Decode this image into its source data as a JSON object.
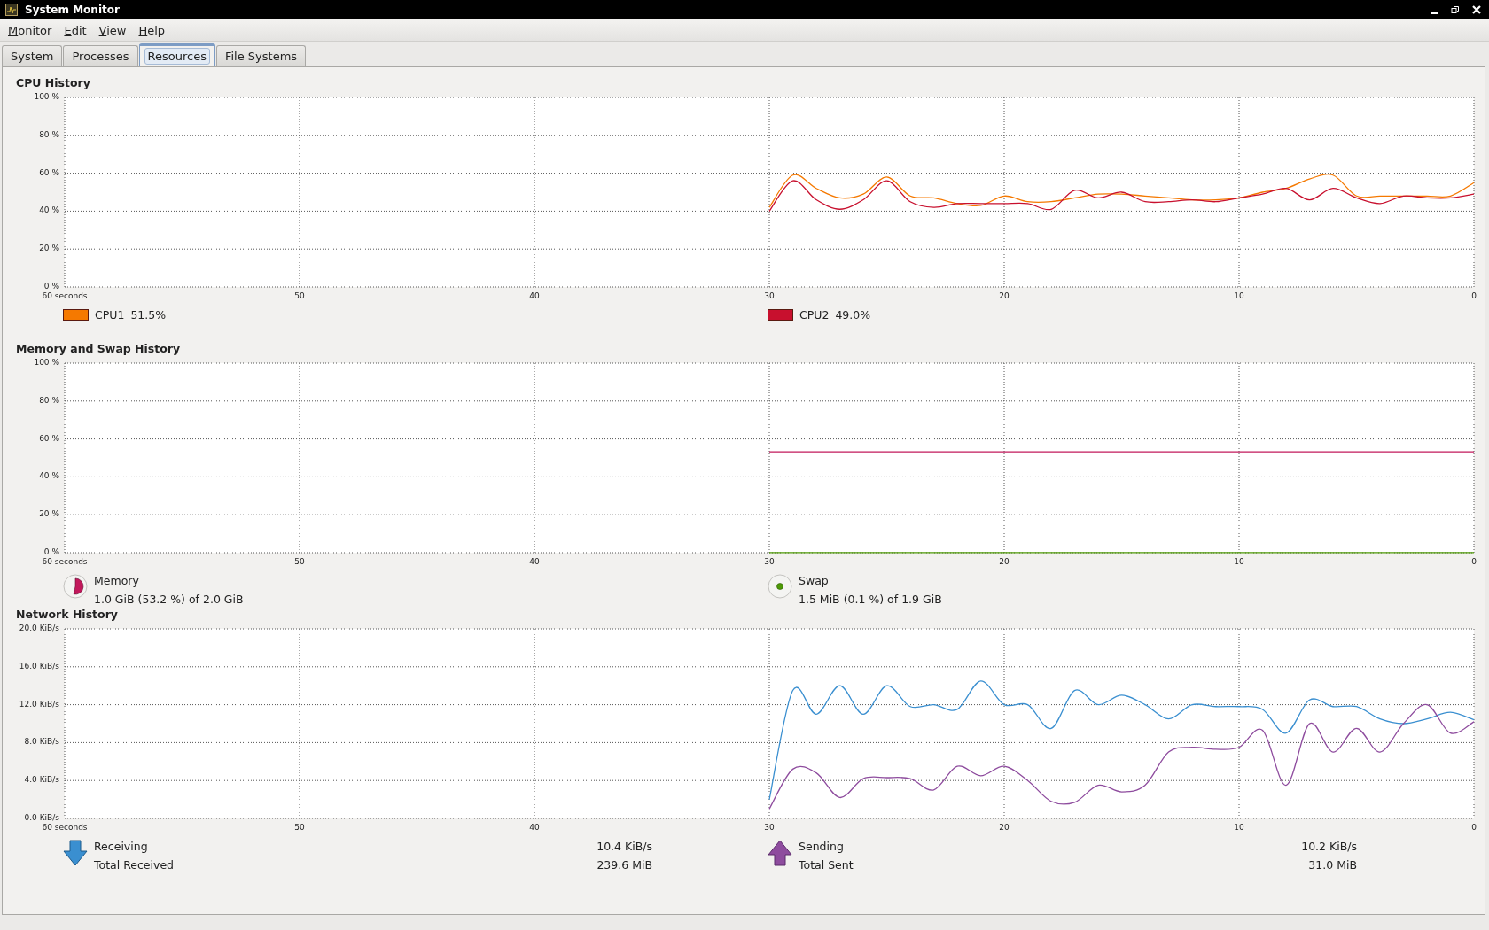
{
  "window": {
    "title": "System Monitor"
  },
  "menu": [
    {
      "label": "Monitor"
    },
    {
      "label": "Edit"
    },
    {
      "label": "View"
    },
    {
      "label": "Help"
    }
  ],
  "tabs": [
    {
      "label": "System",
      "selected": false
    },
    {
      "label": "Processes",
      "selected": false
    },
    {
      "label": "Resources",
      "selected": true
    },
    {
      "label": "File Systems",
      "selected": false
    }
  ],
  "sections": [
    {
      "kind": "cpu",
      "title": "CPU History",
      "chart_data": {
        "type": "line",
        "grid": true,
        "xlim": [
          60,
          0
        ],
        "ylim": [
          0,
          100
        ],
        "xticks": [
          {
            "value": 60,
            "label": "60 seconds"
          },
          {
            "value": 50,
            "label": "50"
          },
          {
            "value": 40,
            "label": "40"
          },
          {
            "value": 30,
            "label": "30"
          },
          {
            "value": 20,
            "label": "20"
          },
          {
            "value": 10,
            "label": "10"
          },
          {
            "value": 0,
            "label": "0"
          }
        ],
        "yticks": [
          {
            "value": 0,
            "label": "0 %"
          },
          {
            "value": 20,
            "label": "20 %"
          },
          {
            "value": 40,
            "label": "40 %"
          },
          {
            "value": 60,
            "label": "60 %"
          },
          {
            "value": 80,
            "label": "80 %"
          },
          {
            "value": 100,
            "label": "100 %"
          }
        ],
        "x": [
          30,
          29,
          28,
          27,
          26,
          25,
          24,
          23,
          22,
          21,
          20,
          19,
          18,
          17,
          16,
          15,
          14,
          13,
          12,
          11,
          10,
          9,
          8,
          7,
          6,
          5,
          4,
          3,
          2,
          1,
          0
        ],
        "series": [
          {
            "name": "CPU1",
            "color": "#f57900",
            "values": [
              42,
              59,
              52,
              47,
              49,
              58,
              48,
              47,
              44,
              43,
              48,
              45,
              45,
              47,
              49,
              49,
              48,
              47,
              46,
              46,
              47,
              50,
              52,
              57,
              59,
              48,
              48,
              48,
              48,
              48,
              55
            ]
          },
          {
            "name": "CPU2",
            "color": "#c8102e",
            "values": [
              40,
              56,
              46,
              41,
              46,
              56,
              45,
              42,
              44,
              44,
              44,
              44,
              41,
              51,
              47,
              50,
              45,
              45,
              46,
              45,
              47,
              49,
              52,
              46,
              52,
              47,
              44,
              48,
              47,
              47,
              49
            ]
          }
        ]
      },
      "legend": [
        {
          "value": "51.5%"
        },
        {
          "value": "49.0%"
        }
      ]
    },
    {
      "kind": "memory",
      "title": "Memory and Swap History",
      "chart_data": {
        "type": "line",
        "grid": true,
        "xlim": [
          60,
          0
        ],
        "ylim": [
          0,
          100
        ],
        "xticks": [
          {
            "value": 60,
            "label": "60 seconds"
          },
          {
            "value": 50,
            "label": "50"
          },
          {
            "value": 40,
            "label": "40"
          },
          {
            "value": 30,
            "label": "30"
          },
          {
            "value": 20,
            "label": "20"
          },
          {
            "value": 10,
            "label": "10"
          },
          {
            "value": 0,
            "label": "0"
          }
        ],
        "yticks": [
          {
            "value": 0,
            "label": "0 %"
          },
          {
            "value": 20,
            "label": "20 %"
          },
          {
            "value": 40,
            "label": "40 %"
          },
          {
            "value": 60,
            "label": "60 %"
          },
          {
            "value": 80,
            "label": "80 %"
          },
          {
            "value": 100,
            "label": "100 %"
          }
        ],
        "x": [
          30,
          25,
          20,
          15,
          10,
          5,
          0
        ],
        "series": [
          {
            "name": "Memory",
            "color": "#c2185b",
            "values": [
              53.2,
              53.2,
              53.2,
              53.2,
              53.2,
              53.2,
              53.2
            ]
          },
          {
            "name": "Swap",
            "color": "#4e9a06",
            "values": [
              0.1,
              0.1,
              0.1,
              0.1,
              0.1,
              0.1,
              0.1
            ]
          }
        ]
      },
      "legend": [
        {
          "value": "1.0 GiB (53.2 %) of 2.0 GiB"
        },
        {
          "value": "1.5 MiB (0.1 %) of 1.9 GiB"
        }
      ]
    },
    {
      "kind": "network",
      "title": "Network History",
      "chart_data": {
        "type": "line",
        "grid": true,
        "xlim": [
          60,
          0
        ],
        "ylim": [
          0,
          20
        ],
        "xticks": [
          {
            "value": 60,
            "label": "60 seconds"
          },
          {
            "value": 50,
            "label": "50"
          },
          {
            "value": 40,
            "label": "40"
          },
          {
            "value": 30,
            "label": "30"
          },
          {
            "value": 20,
            "label": "20"
          },
          {
            "value": 10,
            "label": "10"
          },
          {
            "value": 0,
            "label": "0"
          }
        ],
        "yticks": [
          {
            "value": 0,
            "label": "0.0 KiB/s"
          },
          {
            "value": 4,
            "label": "4.0 KiB/s"
          },
          {
            "value": 8,
            "label": "8.0 KiB/s"
          },
          {
            "value": 12,
            "label": "12.0 KiB/s"
          },
          {
            "value": 16,
            "label": "16.0 KiB/s"
          },
          {
            "value": 20,
            "label": "20.0 KiB/s"
          }
        ],
        "x": [
          30,
          29,
          28,
          27,
          26,
          25,
          24,
          23,
          22,
          21,
          20,
          19,
          18,
          17,
          16,
          15,
          14,
          13,
          12,
          11,
          10,
          9,
          8,
          7,
          6,
          5,
          4,
          3,
          2,
          1,
          0
        ],
        "series": [
          {
            "name": "Receiving",
            "color": "#3a8fd0",
            "values": [
              2,
              13.5,
              11,
              14,
              11,
              14,
              11.8,
              12,
              11.5,
              14.5,
              12,
              12,
              9.5,
              13.5,
              12,
              13,
              12,
              10.5,
              12,
              11.8,
              11.8,
              11.5,
              9,
              12.5,
              11.8,
              11.8,
              10.5,
              10,
              10.5,
              11.2,
              10.4
            ]
          },
          {
            "name": "Sending",
            "color": "#8e4c9e",
            "values": [
              1,
              5.2,
              4.8,
              2.2,
              4.2,
              4.3,
              4.2,
              3,
              5.5,
              4.5,
              5.5,
              4,
              1.8,
              1.7,
              3.5,
              2.8,
              3.5,
              7,
              7.5,
              7.3,
              7.5,
              9.3,
              3.5,
              10,
              7,
              9.5,
              7,
              10,
              12,
              9,
              10.2
            ]
          }
        ]
      },
      "legend": [
        {
          "kind": "receive",
          "value": "10.4 KiB/s",
          "total_label": "Total Received",
          "total": "239.6 MiB"
        },
        {
          "kind": "send",
          "value": "10.2 KiB/s",
          "total_label": "Total Sent",
          "total": "31.0 MiB"
        }
      ]
    }
  ]
}
